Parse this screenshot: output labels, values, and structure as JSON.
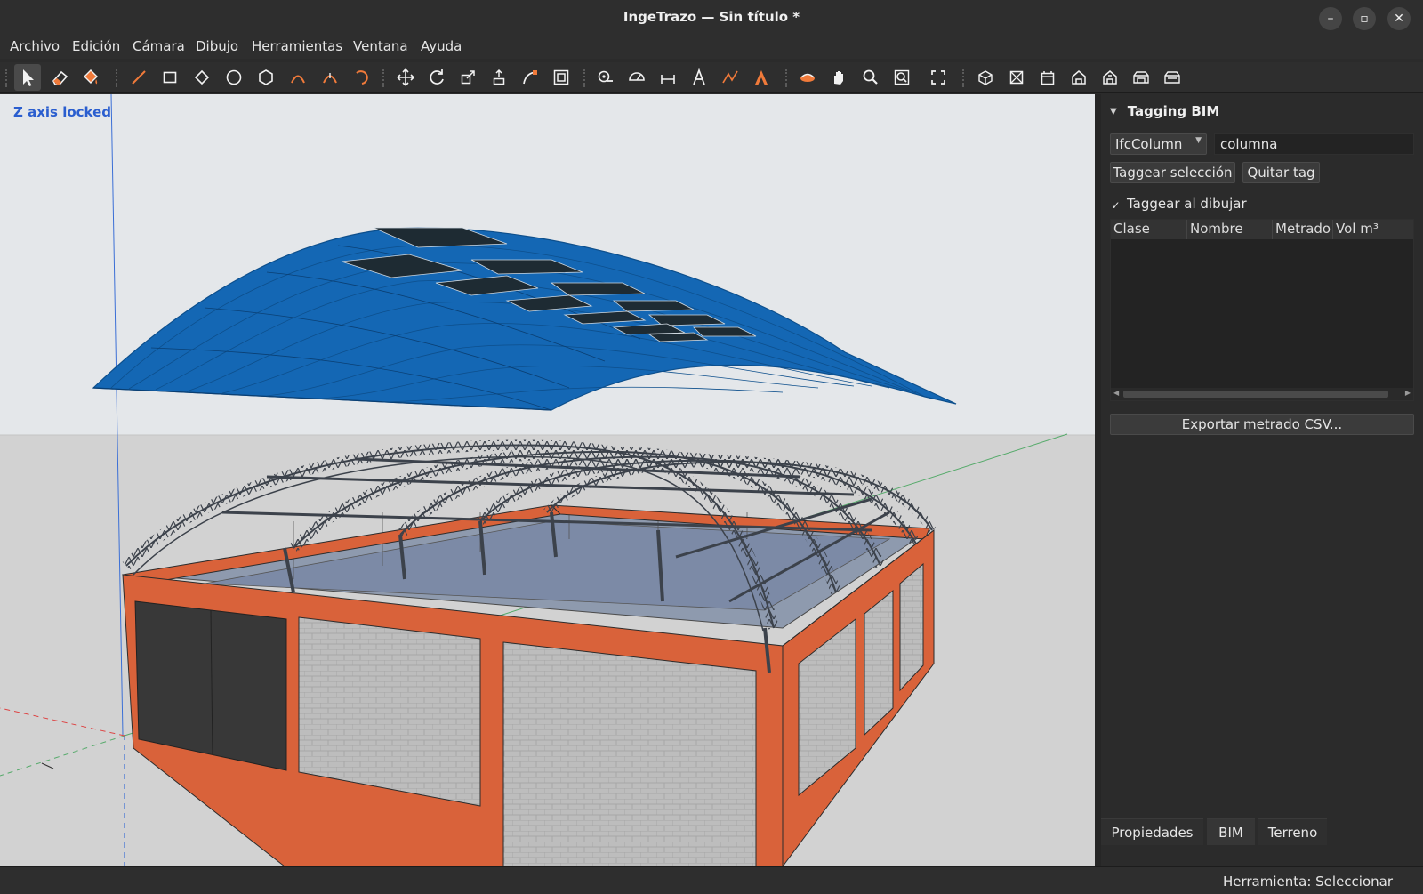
{
  "window": {
    "title": "IngeTrazo — Sin título *",
    "controls": {
      "minimize": "–",
      "maximize": "▫",
      "close": "✕"
    }
  },
  "menu": [
    "Archivo",
    "Edición",
    "Cámara",
    "Dibujo",
    "Herramientas",
    "Ventana",
    "Ayuda"
  ],
  "toolbar": {
    "groups": [
      [
        "select-icon",
        "eraser-icon",
        "paint-bucket-icon"
      ],
      [
        "line-icon",
        "rectangle-icon",
        "rotated-rectangle-icon",
        "circle-icon",
        "polygon-icon",
        "arc-icon",
        "two-point-arc-icon",
        "pie-icon"
      ],
      [
        "move-icon",
        "rotate-icon",
        "scale-icon",
        "push-pull-icon",
        "follow-me-icon",
        "offset-icon"
      ],
      [
        "tape-measure-icon",
        "protractor-icon",
        "dimension-icon",
        "text-icon",
        "axes-icon",
        "3d-text-icon"
      ],
      [
        "orbit-icon",
        "pan-icon",
        "zoom-icon",
        "zoom-window-icon"
      ],
      [
        "zoom-extents-icon"
      ],
      [
        "iso-view-icon",
        "top-view-icon",
        "front-view-icon",
        "right-view-icon",
        "back-view-icon",
        "left-view-icon",
        "bottom-view-icon"
      ]
    ],
    "active": "select-icon"
  },
  "viewport": {
    "overlay_text": "Z axis locked",
    "colors": {
      "sky": "#e4e7ea",
      "ground": "#d2d2d2",
      "roof": "#1467b4",
      "roof_dark": "#0d4f8c",
      "frame": "#d9623a",
      "block": "#bdbdbd",
      "steel": "#3c424b",
      "door": "#383838",
      "glass": "#7c8aa6"
    }
  },
  "panel": {
    "section_title": "Tagging BIM",
    "ifc_class": "IfcColumn",
    "name_value": "columna",
    "buttons": {
      "tag_selection": "Taggear selección",
      "remove_tag": "Quitar tag",
      "export_csv": "Exportar metrado CSV..."
    },
    "checkbox": {
      "label": "Taggear al dibujar",
      "checked": true,
      "mark": "✓"
    },
    "table_columns": [
      "Clase",
      "Nombre",
      "Metrado",
      "Vol m³"
    ],
    "table_rows": [],
    "tabs": [
      "Propiedades",
      "BIM",
      "Terreno"
    ],
    "active_tab": "BIM"
  },
  "statusbar": {
    "text": "Herramienta: Seleccionar"
  }
}
